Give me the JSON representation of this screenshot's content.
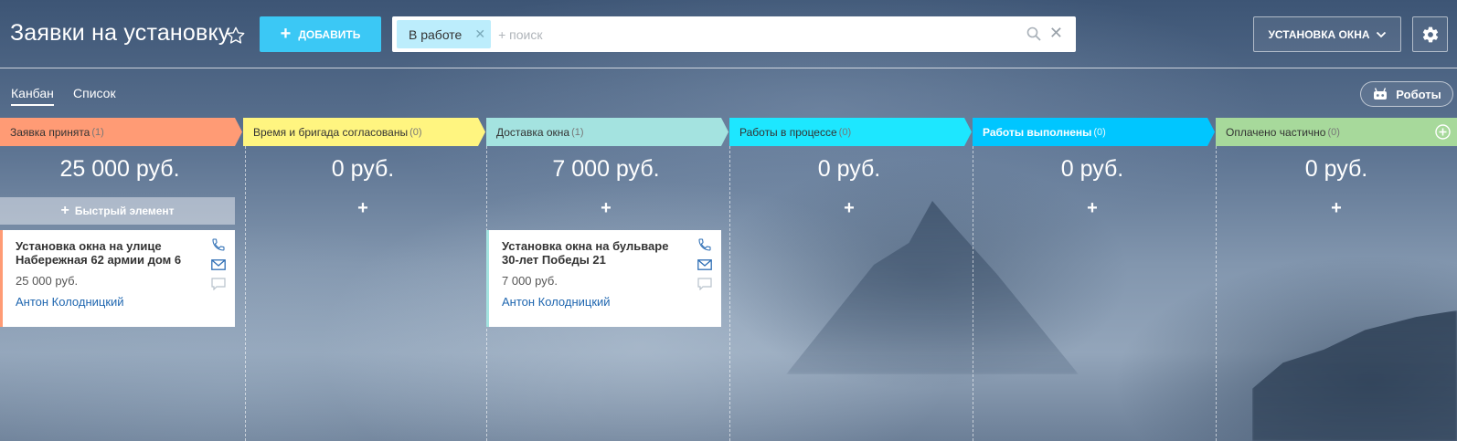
{
  "header": {
    "title": "Заявки на установку",
    "add_button": "ДОБАВИТЬ",
    "filter_tag": "В работе",
    "search_placeholder": "+ поиск",
    "category_button": "УСТАНОВКА ОКНА",
    "icons": [
      "star-icon",
      "plus-icon",
      "search-icon",
      "close-icon",
      "chevron-down-icon",
      "gear-icon"
    ]
  },
  "tabs": [
    {
      "label": "Канбан",
      "active": true
    },
    {
      "label": "Список",
      "active": false
    }
  ],
  "robots_button": "Роботы",
  "quick_add_label": "Быстрый элемент",
  "column_add_symbol": "+",
  "columns": [
    {
      "title": "Заявка принята",
      "count": "(1)",
      "sum": "25 000 руб.",
      "color": "#ff9b75"
    },
    {
      "title": "Время и бригада согласованы",
      "count": "(0)",
      "sum": "0 руб.",
      "color": "#fff580"
    },
    {
      "title": "Доставка окна",
      "count": "(1)",
      "sum": "7 000 руб.",
      "color": "#a4e3e0"
    },
    {
      "title": "Работы в процессе",
      "count": "(0)",
      "sum": "0 руб.",
      "color": "#1de7ff"
    },
    {
      "title": "Работы выполнены",
      "count": "(0)",
      "sum": "0 руб.",
      "color": "#00c6ff"
    },
    {
      "title": "Оплачено частично",
      "count": "(0)",
      "sum": "0 руб.",
      "color": "#a7d99b"
    }
  ],
  "cards": [
    {
      "title": "Установка окна на улице Набережная 62 армии дом 6",
      "price": "25 000 руб.",
      "person": "Антон Колодницкий",
      "accent": "#ff9b75",
      "icons": [
        "phone-icon",
        "mail-icon",
        "chat-icon"
      ]
    },
    {
      "title": "Установка окна на бульваре 30-лет Победы 21",
      "price": "7 000 руб.",
      "person": "Антон Колодницкий",
      "accent": "#a4e3e0",
      "icons": [
        "phone-icon",
        "mail-icon",
        "chat-icon"
      ]
    }
  ]
}
